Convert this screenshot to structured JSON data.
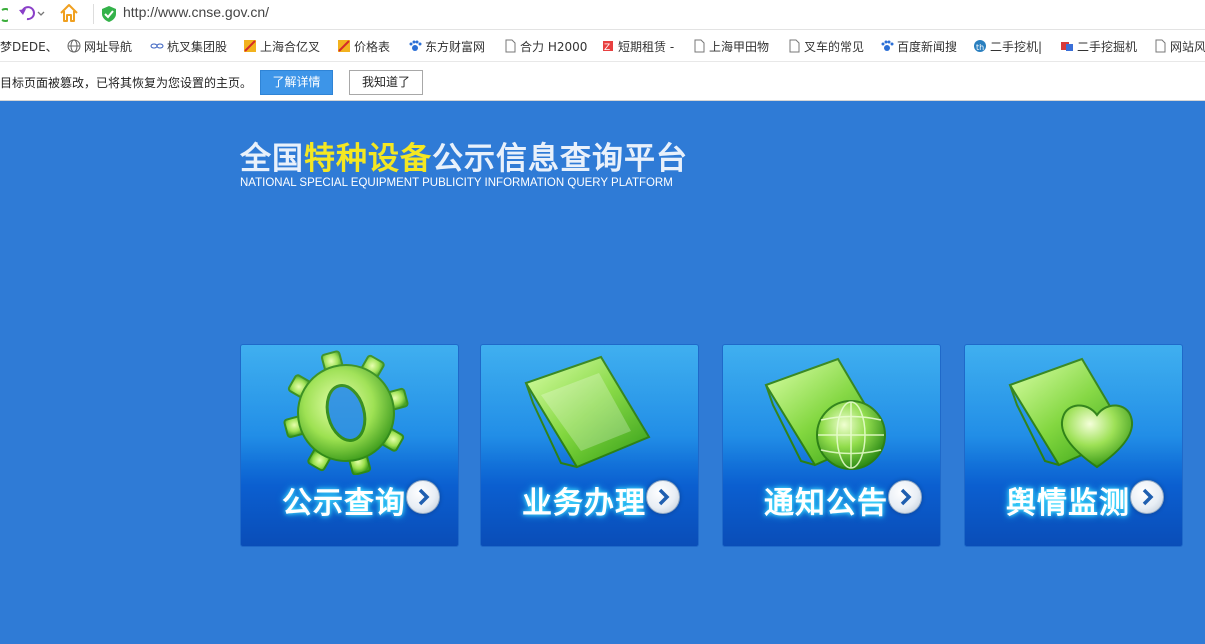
{
  "browser": {
    "url": "http://www.cnse.gov.cn/"
  },
  "bookmarks": [
    {
      "label": "梦DEDE、",
      "icon": "none"
    },
    {
      "label": "网址导航",
      "icon": "globe-icon"
    },
    {
      "label": "杭叉集团股",
      "icon": "link-icon"
    },
    {
      "label": "上海合亿叉",
      "icon": "site-icon"
    },
    {
      "label": "价格表",
      "icon": "site-icon"
    },
    {
      "label": "东方财富网",
      "icon": "paw-icon"
    },
    {
      "label": "合力 H2000",
      "icon": "page-icon"
    },
    {
      "label": "短期租赁 -",
      "icon": "site-icon"
    },
    {
      "label": "上海甲田物",
      "icon": "page-icon"
    },
    {
      "label": "叉车的常见",
      "icon": "page-icon"
    },
    {
      "label": "百度新闻搜",
      "icon": "paw-icon"
    },
    {
      "label": "二手挖机|",
      "icon": "site-icon"
    },
    {
      "label": "二手挖掘机",
      "icon": "site-icon"
    },
    {
      "label": "网站风",
      "icon": "page-icon"
    }
  ],
  "notice": {
    "text": "目标页面被篡改，已将其恢复为您设置的主页。",
    "learn_label": "了解详情",
    "ok_label": "我知道了"
  },
  "site": {
    "title_pre": "全国",
    "title_highlight": "特种设备",
    "title_post": "公示信息查询平台",
    "subtitle": "NATIONAL SPECIAL EQUIPMENT PUBLICITY INFORMATION QUERY PLATFORM"
  },
  "tiles": [
    {
      "label": "公示查询",
      "icon": "gear-icon"
    },
    {
      "label": "业务办理",
      "icon": "folder-icon"
    },
    {
      "label": "通知公告",
      "icon": "folder-globe-icon"
    },
    {
      "label": "舆情监测",
      "icon": "folder-heart-icon"
    }
  ],
  "colors": {
    "page_bg": "#2f7bd6",
    "title_highlight": "#f4e722",
    "learn_button": "#3d95e8"
  }
}
